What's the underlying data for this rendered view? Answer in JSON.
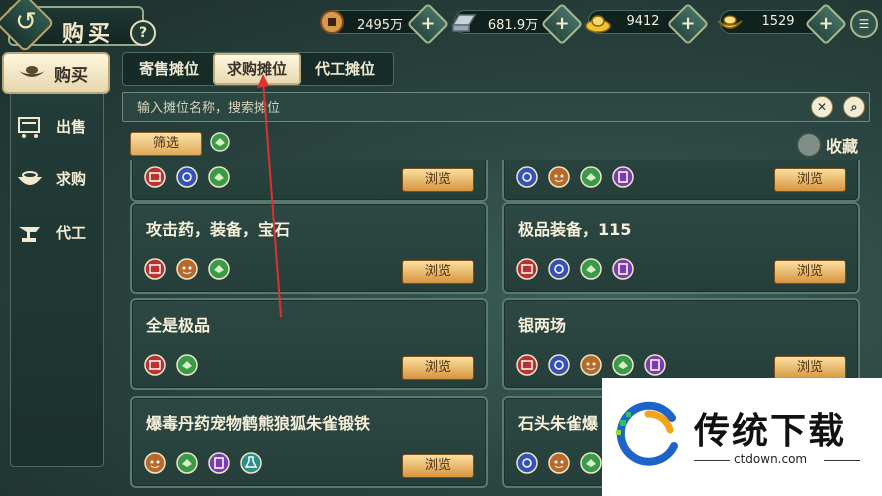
{
  "header": {
    "title": "购买",
    "help_label": "?"
  },
  "resources": [
    {
      "name": "copper-coin",
      "value": "2495万",
      "color": "#d89a4b"
    },
    {
      "name": "silver-ingot",
      "value": "681.9万",
      "color": "#c8d2dc"
    },
    {
      "name": "gold-ingot",
      "value": "9412",
      "color": "#f1c232"
    },
    {
      "name": "yellow-ingot",
      "value": "1529",
      "color": "#f4c430"
    }
  ],
  "sidebar": {
    "items": [
      {
        "label": "购买",
        "icon": "ingot-icon",
        "active": true
      },
      {
        "label": "出售",
        "icon": "cart-icon"
      },
      {
        "label": "求购",
        "icon": "bowl-icon"
      },
      {
        "label": "代工",
        "icon": "anvil-icon"
      }
    ]
  },
  "tabs": [
    {
      "label": "寄售摊位",
      "active": false
    },
    {
      "label": "求购摊位",
      "active": true
    },
    {
      "label": "代工摊位",
      "active": false
    }
  ],
  "search": {
    "placeholder": "输入摊位名称，搜索摊位"
  },
  "filter": {
    "label": "筛选"
  },
  "favorite": {
    "label": "收藏",
    "checked": false
  },
  "stalls": [
    {
      "name": "",
      "icons": [
        "red-armor",
        "blue-gem",
        "green-book"
      ],
      "button": "浏览"
    },
    {
      "name": "",
      "icons": [
        "blue-gem",
        "tiger-pet",
        "green-book",
        "purple-scroll"
      ],
      "button": "浏览"
    },
    {
      "name": "攻击药，装备，宝石",
      "icons": [
        "red-armor",
        "tiger-pet",
        "green-book"
      ],
      "button": "浏览"
    },
    {
      "name": "极品装备，115",
      "icons": [
        "red-armor",
        "blue-gem",
        "green-book",
        "purple-scroll"
      ],
      "button": "浏览"
    },
    {
      "name": "全是极品",
      "icons": [
        "red-armor",
        "green-book"
      ],
      "button": "浏览"
    },
    {
      "name": "银两场",
      "icons": [
        "red-armor",
        "blue-gem",
        "tiger-pet",
        "green-book",
        "purple-scroll"
      ],
      "button": "浏览"
    },
    {
      "name": "爆毒丹药宠物鹤熊狼狐朱雀锻铁",
      "icons": [
        "tiger-pet",
        "green-book",
        "purple-scroll",
        "potion-flask"
      ],
      "button": "浏览"
    },
    {
      "name": "石头朱雀爆",
      "icons": [
        "blue-gem",
        "tiger-pet",
        "green-book"
      ],
      "button": "浏览"
    }
  ],
  "watermark": {
    "brand": "传统下载",
    "site": "ctdown.com"
  },
  "colors": {
    "accent_gold": "#e0a85a",
    "panel_bg": "#2d4843",
    "annotation_red": "#e03030"
  }
}
